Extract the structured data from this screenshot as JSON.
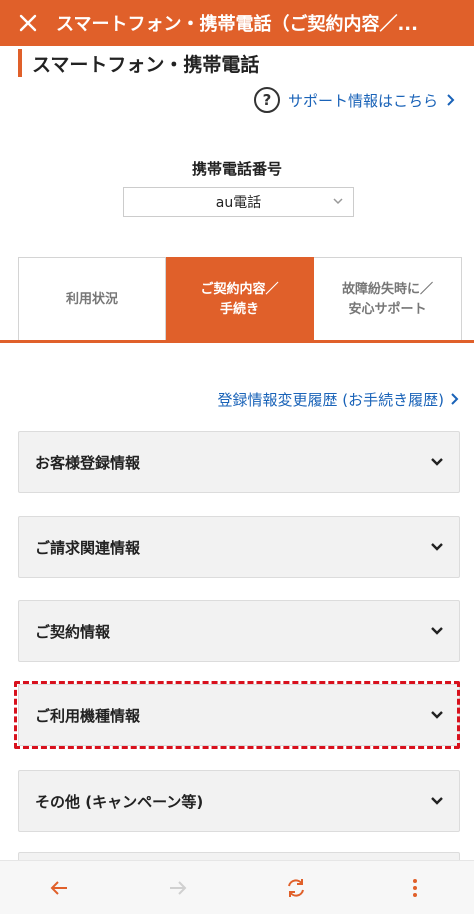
{
  "titlebar": {
    "title": "スマートフォン・携帯電話（ご契約内容／..."
  },
  "heading": {
    "text": "スマートフォン・携帯電話"
  },
  "support": {
    "label": "サポート情報はこちら"
  },
  "phone": {
    "label": "携帯電話番号",
    "selected": "au電話"
  },
  "tabs": [
    {
      "label_line1": "利用状況",
      "label_line2": "",
      "active": false
    },
    {
      "label_line1": "ご契約内容／",
      "label_line2": "手続き",
      "active": true
    },
    {
      "label_line1": "故障紛失時に／",
      "label_line2": "安心サポート",
      "active": false
    }
  ],
  "history": {
    "label": "登録情報変更履歴 (お手続き履歴)"
  },
  "sections": [
    {
      "label": "お客様登録情報"
    },
    {
      "label": "ご請求関連情報"
    },
    {
      "label": "ご契約情報"
    },
    {
      "label": "ご利用機種情報",
      "highlighted": true
    },
    {
      "label": "その他 (キャンペーン等)"
    }
  ],
  "colors": {
    "accent": "#e0602a",
    "link": "#1a63b8",
    "highlight": "#d8111d"
  },
  "icons": [
    "close-icon",
    "help-icon",
    "chevron-right-icon",
    "chevron-down-icon",
    "back-arrow-icon",
    "forward-arrow-icon",
    "refresh-icon",
    "more-vertical-icon"
  ]
}
